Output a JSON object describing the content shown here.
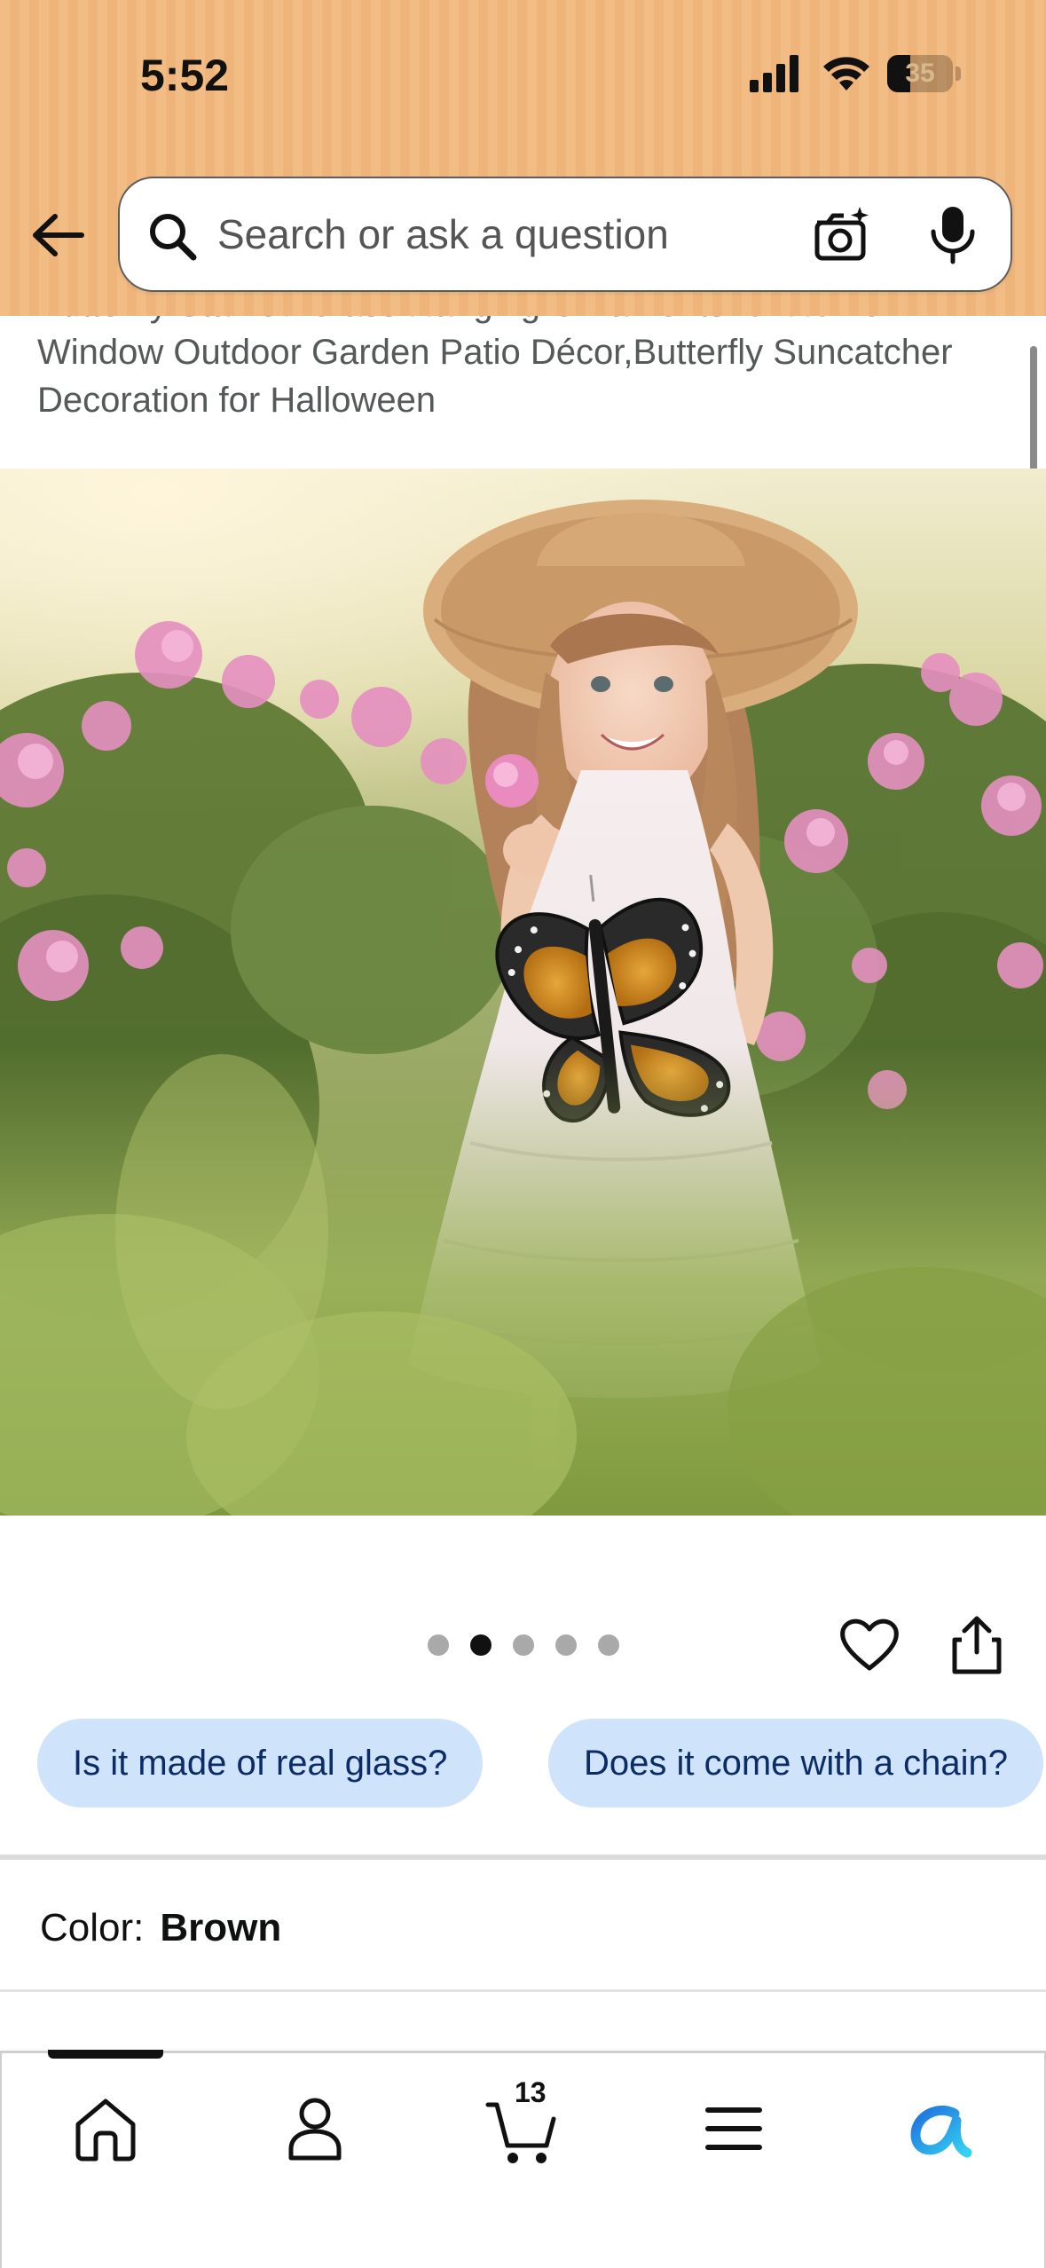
{
  "status_bar": {
    "time": "5:52",
    "battery_percent": 35,
    "battery_label": "35",
    "signal_bars": 4
  },
  "search": {
    "placeholder": "Search or ask a question",
    "value": ""
  },
  "product": {
    "title": "Butterfly Stained Glass Hanging Ornaments for Home Window Outdoor Garden Patio Décor,Butterfly Suncatcher Decoration for Halloween",
    "gallery_total": 5,
    "gallery_active_index": 1
  },
  "questions": [
    "Is it made of real glass?",
    "Does it come with a chain?"
  ],
  "variation": {
    "label": "Color:",
    "value": "Brown"
  },
  "bottom_nav": {
    "items": [
      "home-icon",
      "account-icon",
      "cart-icon",
      "menu-icon",
      "rufus-icon"
    ],
    "cart_count": "13",
    "active": "home-icon"
  },
  "colors": {
    "header": "#f2bd85",
    "chip": "#cfe3fb",
    "chip_text": "#0b2c66",
    "rufus_blue": "#1aa3e8"
  }
}
